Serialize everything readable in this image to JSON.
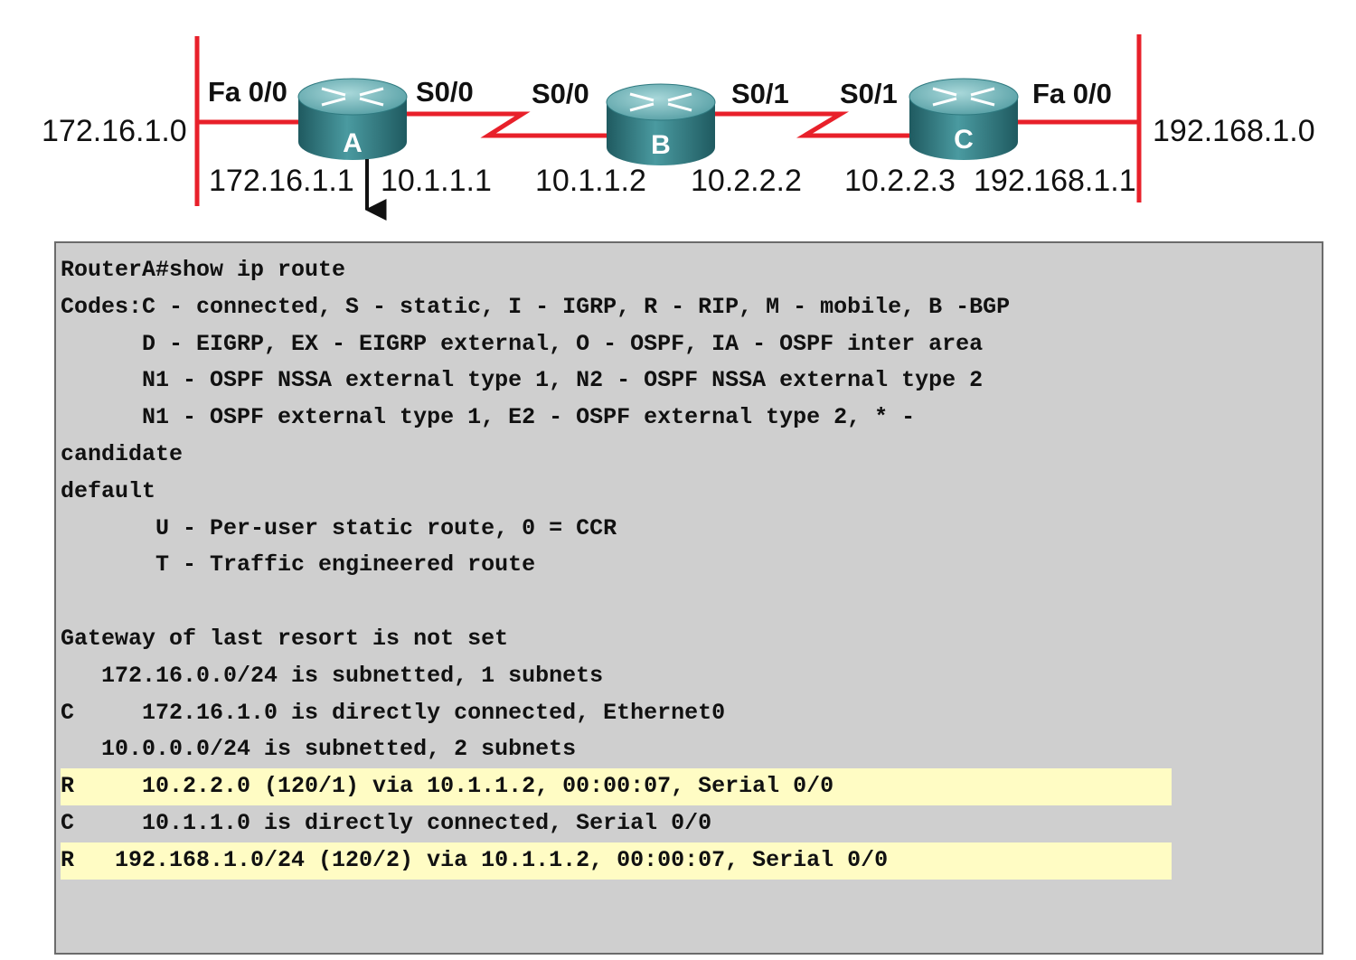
{
  "topology": {
    "colors": {
      "link": "#e8202a",
      "router_body": "#3d8c92",
      "router_top": "#6fb6bb",
      "router_shadow": "#1f5a60"
    },
    "networks": {
      "left": "172.16.1.0",
      "right": "192.168.1.0"
    },
    "routers": [
      {
        "letter": "A",
        "left_iface": "Fa 0/0",
        "right_iface": "S0/0",
        "left_ip": "172.16.1.1",
        "right_ip": "10.1.1.1"
      },
      {
        "letter": "B",
        "left_iface": "S0/0",
        "right_iface": "S0/1",
        "left_ip": "10.1.1.2",
        "right_ip": "10.2.2.2"
      },
      {
        "letter": "C",
        "left_iface": "S0/1",
        "right_iface": "Fa 0/0",
        "left_ip": "10.2.2.3",
        "right_ip": "192.168.1.1"
      }
    ]
  },
  "terminal": {
    "highlight_color": "#fffcc4",
    "lines": [
      {
        "text": "RouterA#show ip route",
        "highlight": false
      },
      {
        "text": "Codes:C - connected, S - static, I - IGRP, R - RIP, M - mobile, B -BGP",
        "highlight": false
      },
      {
        "text": "      D - EIGRP, EX - EIGRP external, O - OSPF, IA - OSPF inter area",
        "highlight": false
      },
      {
        "text": "      N1 - OSPF NSSA external type 1, N2 - OSPF NSSA external type 2",
        "highlight": false
      },
      {
        "text": "      N1 - OSPF external type 1, E2 - OSPF external type 2, * -",
        "highlight": false
      },
      {
        "text": "candidate",
        "highlight": false
      },
      {
        "text": "default",
        "highlight": false
      },
      {
        "text": "       U - Per-user static route, 0 = CCR",
        "highlight": false
      },
      {
        "text": "       T - Traffic engineered route",
        "highlight": false
      },
      {
        "text": "",
        "highlight": false
      },
      {
        "text": "Gateway of last resort is not set",
        "highlight": false
      },
      {
        "text": "   172.16.0.0/24 is subnetted, 1 subnets",
        "highlight": false
      },
      {
        "text": "C     172.16.1.0 is directly connected, Ethernet0",
        "highlight": false
      },
      {
        "text": "   10.0.0.0/24 is subnetted, 2 subnets",
        "highlight": false
      },
      {
        "text": "R     10.2.2.0 (120/1) via 10.1.1.2, 00:00:07, Serial 0/0",
        "highlight": true
      },
      {
        "text": "C     10.1.1.0 is directly connected, Serial 0/0",
        "highlight": false
      },
      {
        "text": "R   192.168.1.0/24 (120/2) via 10.1.1.2, 00:00:07, Serial 0/0",
        "highlight": true
      }
    ]
  }
}
